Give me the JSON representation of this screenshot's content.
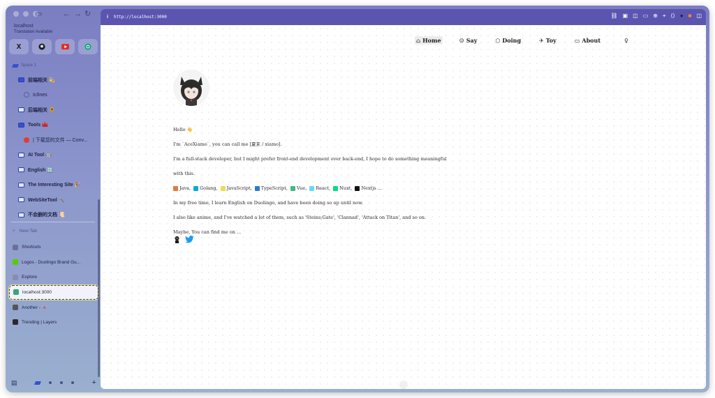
{
  "sidebar": {
    "site_name": "localhost",
    "site_notice": "Translation Available",
    "favorites": [
      {
        "icon": "x-icon",
        "glyph": "X"
      },
      {
        "icon": "github-icon",
        "glyph": "○"
      },
      {
        "icon": "youtube-icon",
        "glyph": "▶"
      },
      {
        "icon": "openai-icon",
        "glyph": "◎"
      }
    ],
    "space_label": "Space 1",
    "folders": [
      {
        "label": "前端相关 💫",
        "sub": false,
        "filled": true
      },
      {
        "label": "Icônes",
        "sub": true
      },
      {
        "label": "后端相关 🌻",
        "sub": false
      },
      {
        "label": "Tools 🧰",
        "sub": false,
        "filled": true
      },
      {
        "label": "| 下载您的文件 — Conv...",
        "sub": true
      },
      {
        "label": "AI Tool 🤖",
        "sub": false
      },
      {
        "label": "English 🔠",
        "sub": false
      },
      {
        "label": "The Interesting Site 🎉",
        "sub": false
      },
      {
        "label": "WebSiteTool 🔨",
        "sub": false
      },
      {
        "label": "不会删的文档 📜",
        "sub": false
      }
    ],
    "new_tab": "New Tab",
    "tabs": [
      {
        "label": "Shortcuts",
        "color": "#6b6f9a"
      },
      {
        "label": "Logos - Duolingo Brand Gu...",
        "color": "#58cc02"
      },
      {
        "label": "Explore",
        "color": "#8a8ab0"
      },
      {
        "label": "localhost:3000",
        "color": "#3aa57a",
        "active": true
      },
      {
        "label": "Another - 🔺",
        "color": "#555555"
      },
      {
        "label": "Trending | Layers",
        "color": "#2a2a2a"
      }
    ]
  },
  "browser": {
    "url_info": "i",
    "url": "http://localhost:3000"
  },
  "nav": {
    "home": "Home",
    "say": "Say",
    "doing": "Doing",
    "toy": "Toy",
    "about": "About"
  },
  "content": {
    "hello": "Hello 👋",
    "intro": "I'm `AceXiamo`, you can call me [夏末 / xiamo].",
    "line1": "I'm a full-stack developer, but I might prefer front-end development over back-end, I hope to do something meaningful",
    "line2": "with this.",
    "tech": [
      {
        "label": "Java,",
        "color": "#e07b39"
      },
      {
        "label": "Golang,",
        "color": "#00acd7"
      },
      {
        "label": "JavaScript,",
        "color": "#f0db4f"
      },
      {
        "label": "TypeScript,",
        "color": "#3178c6"
      },
      {
        "label": "Vue,",
        "color": "#42b883"
      },
      {
        "label": "React,",
        "color": "#61dafb"
      },
      {
        "label": "Nuxt,",
        "color": "#00dc82"
      },
      {
        "label": "Nextjs ...",
        "color": "#111111"
      }
    ],
    "free_time": "In my free time, I learn English on Duolingo, and have been doing so up until now.",
    "anime": "I also like anime, and I've watched a lot of them, such as 'Steins;Gate', 'Clannad', 'Attack on Titan', and so on.",
    "find_me": "Maybe, You can find me on ..."
  }
}
